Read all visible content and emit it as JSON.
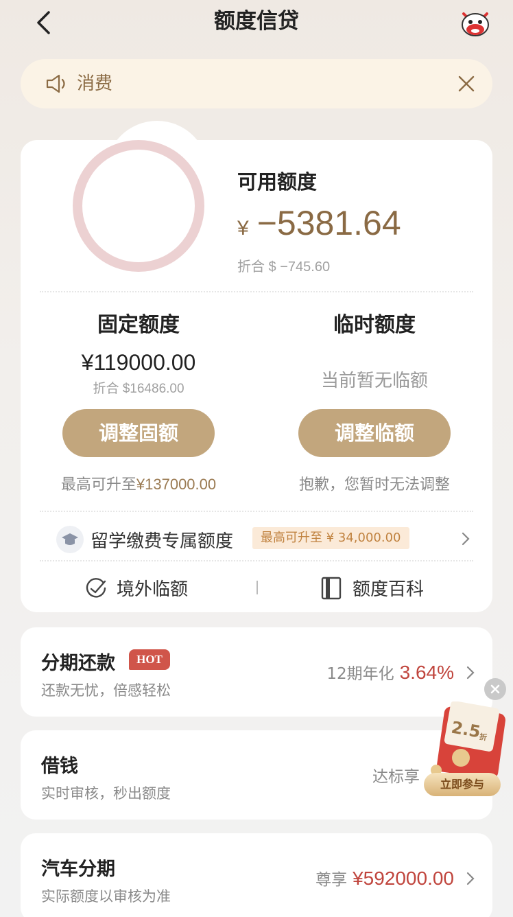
{
  "header": {
    "title": "额度信贷",
    "back_icon": "chevron-left-icon",
    "mascot_icon": "cow-mascot-icon"
  },
  "notice": {
    "text": "消费",
    "icon": "speaker-icon",
    "close_icon": "close-icon"
  },
  "available": {
    "label": "可用额度",
    "currency": "¥",
    "amount": "−5381.64",
    "converted": "折合 $ −745.60"
  },
  "fixed": {
    "title": "固定额度",
    "amount": "¥119000.00",
    "converted": "折合 $16486.00",
    "button": "调整固额",
    "note_prefix": "最高可升至",
    "note_value": "¥137000.00"
  },
  "temporary": {
    "title": "临时额度",
    "status": "当前暂无临额",
    "button": "调整临额",
    "note": "抱歉，您暂时无法调整"
  },
  "study": {
    "label": "留学缴费专属额度",
    "badge": "最高可升至 ¥ 34,000.00",
    "icon": "graduation-cap-icon"
  },
  "links": [
    {
      "label": "境外临额",
      "icon": "plane-globe-icon"
    },
    {
      "label": "额度百科",
      "icon": "book-icon"
    }
  ],
  "products": [
    {
      "title": "分期还款",
      "badge": "HOT",
      "sub": "还款无忧，倍感轻松",
      "right_label": "12期年化",
      "right_value": "3.64%"
    },
    {
      "title": "借钱",
      "sub": "实时审核，秒出额度",
      "right_label": "达标享",
      "right_value": ""
    },
    {
      "title": "汽车分期",
      "sub": "实际额度以审核为准",
      "right_label": "尊享",
      "right_value": "¥592000.00"
    }
  ],
  "promo": {
    "button": "立即参与",
    "value": "2.5",
    "unit": "折"
  },
  "colors": {
    "accent": "#c2a67d",
    "amount": "#8a6a44",
    "red": "#c0453d",
    "ring": "#ecd1d2"
  }
}
